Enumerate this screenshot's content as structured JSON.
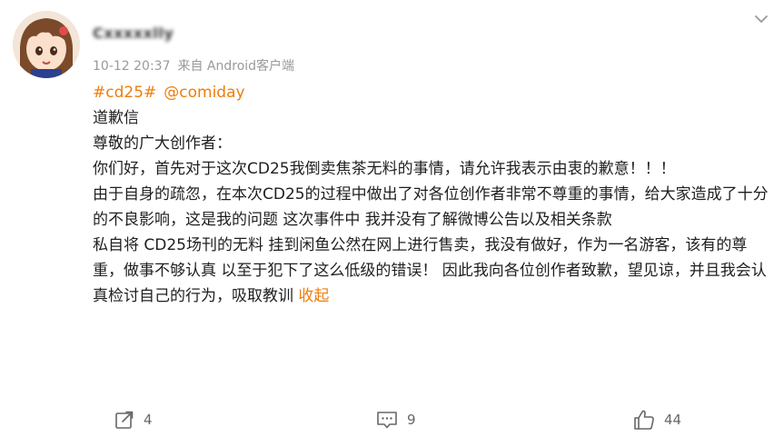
{
  "post": {
    "username": "Cxxxxxlly",
    "time": "10-12 20:37",
    "source": "来自 Android客户端",
    "hashtag": "#cd25#",
    "mention": "@comiday",
    "lines": [
      "道歉信",
      "尊敬的广大创作者：",
      "你们好，首先对于这次CD25我倒卖焦茶无料的事情，请允许我表示由衷的歉意！！！",
      "由于自身的疏忽，在本次CD25的过程中做出了对各位创作者非常不尊重的事情，给大家造成了十分的不良影响，这是我的问题 这次事件中 我并没有了解微博公告以及相关条款",
      "私自将 CD25场刊的无料 挂到闲鱼公然在网上进行售卖，我没有做好，作为一名游客，该有的尊重，做事不够认真 以至于犯下了这么低级的错误！ 因此我向各位创作者致歉，望见谅，并且我会认真检讨自己的行为，吸取教训"
    ],
    "collapse_label": "收起"
  },
  "actions": {
    "repost_count": "4",
    "comment_count": "9",
    "like_count": "44"
  },
  "icons": {
    "more": "chevron-down-icon",
    "repost": "repost-icon",
    "comment": "comment-icon",
    "like": "thumbs-up-icon"
  },
  "colors": {
    "link": "#ef7d0a",
    "meta": "#9a9a9a",
    "text": "#1f1f1f"
  }
}
